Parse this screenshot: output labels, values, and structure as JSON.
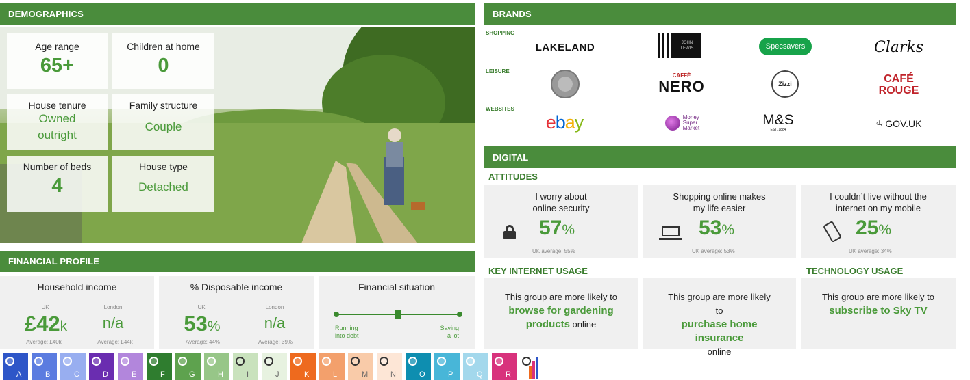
{
  "demographics": {
    "header": "DEMOGRAPHICS",
    "cards": [
      {
        "label": "Age range",
        "value": "65+"
      },
      {
        "label": "Children at home",
        "value": "0"
      },
      {
        "label": "House tenure",
        "value_line1": "Owned",
        "value_line2": "outright"
      },
      {
        "label": "Family structure",
        "value": "Couple"
      },
      {
        "label": "Number of beds",
        "value": "4"
      },
      {
        "label": "House type",
        "value": "Detached"
      }
    ]
  },
  "financial": {
    "header": "FINANCIAL PROFILE",
    "household_income": {
      "title": "Household income",
      "uk_label": "UK",
      "london_label": "London",
      "uk_value": "£42",
      "uk_unit": "k",
      "london_value": "n/a",
      "uk_avg": "Average: £40k",
      "london_avg": "Average: £44k"
    },
    "disposable_income": {
      "title": "% Disposable income",
      "uk_label": "UK",
      "london_label": "London",
      "uk_value": "53",
      "uk_unit": "%",
      "london_value": "n/a",
      "uk_avg": "Average: 44%",
      "london_avg": "Average: 39%"
    },
    "situation": {
      "title": "Financial situation",
      "left_line1": "Running",
      "left_line2": "into debt",
      "right_line1": "Saving",
      "right_line2": "a lot",
      "marker_position": 0.5
    }
  },
  "brands": {
    "header": "BRANDS",
    "rows": [
      {
        "label": "SHOPPING",
        "logos": [
          "LAKELAND",
          "JOHN LEWIS",
          "Specsavers",
          "Clarks"
        ]
      },
      {
        "label": "LEISURE",
        "logos": [
          "",
          "NERO",
          "Zizzi",
          "CAFÉ ROUGE"
        ]
      },
      {
        "label": "WEBSITES",
        "logos": [
          "ebay",
          "Money Super Market",
          "M&S",
          "GOV.UK"
        ]
      }
    ],
    "nero_top": "CAFFÈ",
    "cafe": "CAFÉ",
    "rouge": "ROUGE",
    "msm_lines": [
      "Money",
      "Super",
      "Market"
    ],
    "ms_sub": "EST. 1884",
    "jl_lines": [
      "JOHN",
      "LEWIS"
    ]
  },
  "digital": {
    "header": "DIGITAL",
    "attitudes_label": "ATTITUDES",
    "attitudes": [
      {
        "line1": "I worry about",
        "line2": "online security",
        "pct": "57",
        "avg": "UK average: 55%",
        "icon": "lock-icon"
      },
      {
        "line1": "Shopping online makes",
        "line2": "my life easier",
        "pct": "53",
        "avg": "UK average: 53%",
        "icon": "laptop-icon"
      },
      {
        "line1": "I couldn’t live without the",
        "line2": "internet on my mobile",
        "pct": "25",
        "avg": "UK average: 34%",
        "icon": "mobile-phone-icon"
      }
    ],
    "pct_sign": "%",
    "key_usage_label": "KEY INTERNET USAGE",
    "tech_usage_label": "TECHNOLOGY USAGE",
    "key_usage": [
      {
        "pre": "This group are more likely to",
        "bold": "browse for gardening products",
        "post": "online"
      },
      {
        "pre": "This group are more likely to",
        "bold": "purchase home insurance",
        "post": "online"
      }
    ],
    "tech_usage": {
      "pre": "This group are more likely to",
      "bold": "subscribe to Sky TV"
    }
  },
  "swatches": [
    {
      "letter": "A",
      "color": "#2e56c8"
    },
    {
      "letter": "B",
      "color": "#5b7ce0"
    },
    {
      "letter": "C",
      "color": "#98aef0"
    },
    {
      "letter": "D",
      "color": "#6a2db0"
    },
    {
      "letter": "E",
      "color": "#b286dc"
    },
    {
      "letter": "F",
      "color": "#2f7d2f"
    },
    {
      "letter": "G",
      "color": "#5ea24e"
    },
    {
      "letter": "H",
      "color": "#97c688"
    },
    {
      "letter": "I",
      "color": "#c9e2bd"
    },
    {
      "letter": "J",
      "color": "#e7f2e0"
    },
    {
      "letter": "K",
      "color": "#ee6a1e"
    },
    {
      "letter": "L",
      "color": "#f3a06c"
    },
    {
      "letter": "M",
      "color": "#f9cba9"
    },
    {
      "letter": "N",
      "color": "#fde6d6"
    },
    {
      "letter": "O",
      "color": "#0e8eb0"
    },
    {
      "letter": "P",
      "color": "#48b6d8"
    },
    {
      "letter": "Q",
      "color": "#a3d8ec"
    },
    {
      "letter": "R",
      "color": "#d8327c"
    }
  ]
}
